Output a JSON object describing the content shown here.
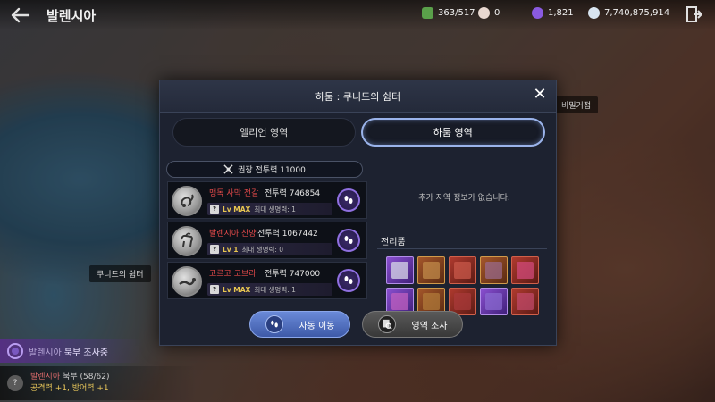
{
  "header": {
    "region_title": "발렌시아",
    "currencies": [
      {
        "name": "energy",
        "value": "363/517",
        "color": "#5aa04a",
        "icon": "energy-icon"
      },
      {
        "name": "pearl",
        "value": "0",
        "color": "#e8d8d0",
        "icon": "pearl-icon"
      },
      {
        "name": "crystal",
        "value": "1,821",
        "color": "#8a5ae0",
        "icon": "crystal-icon"
      },
      {
        "name": "silver",
        "value": "7,740,875,914",
        "color": "#d8e4f0",
        "icon": "silver-icon"
      }
    ]
  },
  "map": {
    "label_shelter": "쿠니드의 쉼터",
    "label_hideout": "비밀거점"
  },
  "exploration": {
    "region": "발렌시아",
    "status": "북부 조사중",
    "bonus_region": "발렌시아",
    "bonus_area": "북부 (58/62)",
    "bonus_stats": "공격력 +1, 방어력 +1"
  },
  "modal": {
    "title": "하둠 : 쿠니드의 쉼터",
    "close": "✕",
    "tabs": [
      {
        "label": "엘리언 영역",
        "active": false
      },
      {
        "label": "하둠 영역",
        "active": true
      }
    ],
    "recommended_power": "권장 전투력 11000",
    "enemies": [
      {
        "name": "맹독 사막 전갈",
        "power": "전투력 746854",
        "level": "Lv MAX",
        "hp": "최대 생명력: 1"
      },
      {
        "name": "발렌시아 산양",
        "power": "전투력 1067442",
        "level": "Lv 1",
        "hp": "최대 생명력: 0"
      },
      {
        "name": "고르고 코브라",
        "power": "전투력 747000",
        "level": "Lv MAX",
        "hp": "최대 생명력: 1"
      }
    ],
    "no_info": "추가 지역 정보가 없습니다.",
    "loot_title": "전리품",
    "buttons": {
      "auto_move": "자동 이동",
      "survey": "영역 조사"
    }
  },
  "colors": {
    "accent_tab": "#9ab3ea",
    "enemy_name": "#e24a4a",
    "level": "#e8c650",
    "auto_button": "#4e6cc0"
  }
}
